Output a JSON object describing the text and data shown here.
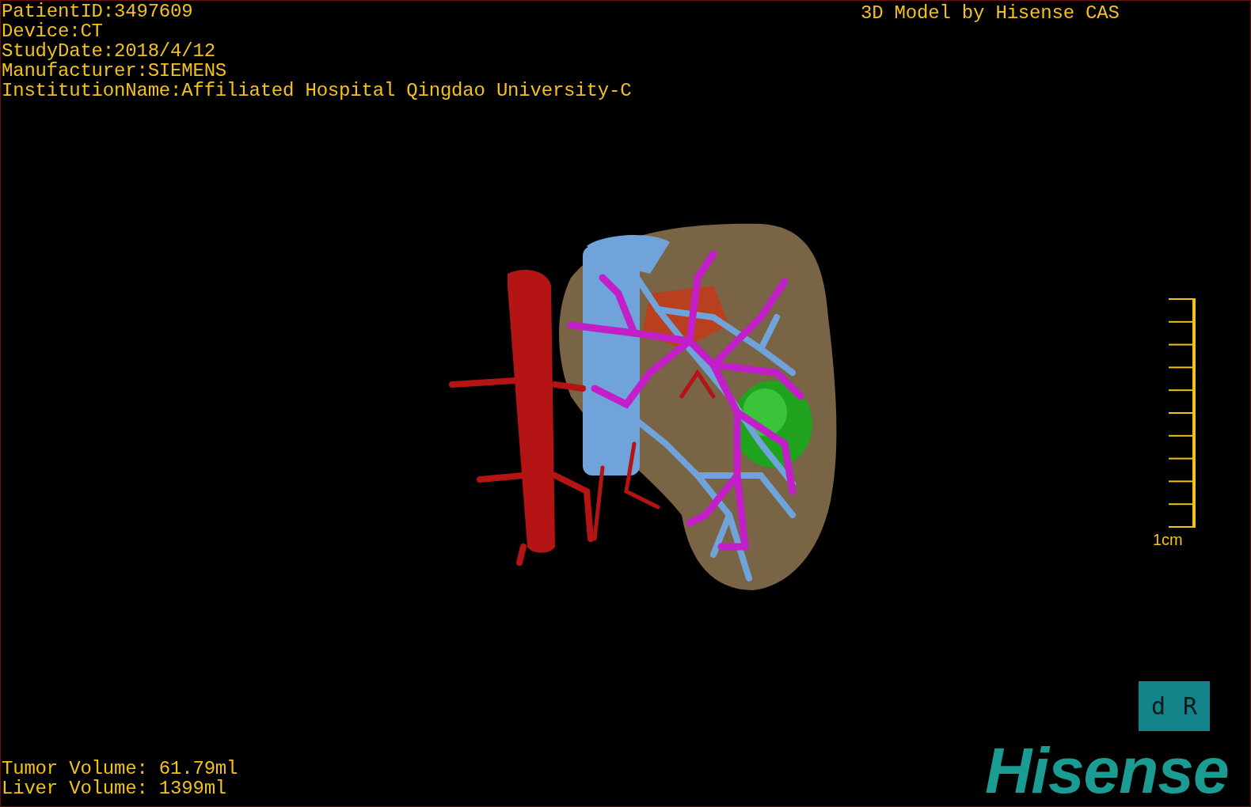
{
  "patient_info": [
    "PatientID:3497609",
    "Device:CT",
    "StudyDate:2018/4/12",
    "Manufacturer:SIEMENS",
    "InstitutionName:Affiliated Hospital Qingdao University-C"
  ],
  "header": "3D Model by Hisense CAS",
  "scale_bar": {
    "label": "1cm"
  },
  "volumes": [
    "Tumor Volume: 61.79ml",
    "Liver Volume: 1399ml"
  ],
  "orientation_marker": [
    "d",
    "R"
  ],
  "logo": "Hisense"
}
